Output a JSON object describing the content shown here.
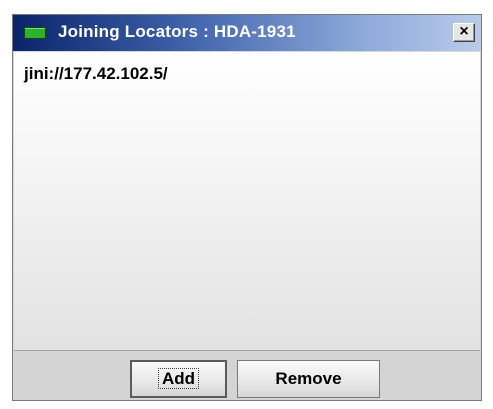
{
  "window": {
    "title": "Joining Locators : HDA-1931",
    "close_label": "×",
    "icon": "app-window-icon"
  },
  "locators": {
    "items": [
      "jini://177.42.102.5/"
    ]
  },
  "buttons": {
    "add_label": "Add",
    "remove_label": "Remove"
  }
}
